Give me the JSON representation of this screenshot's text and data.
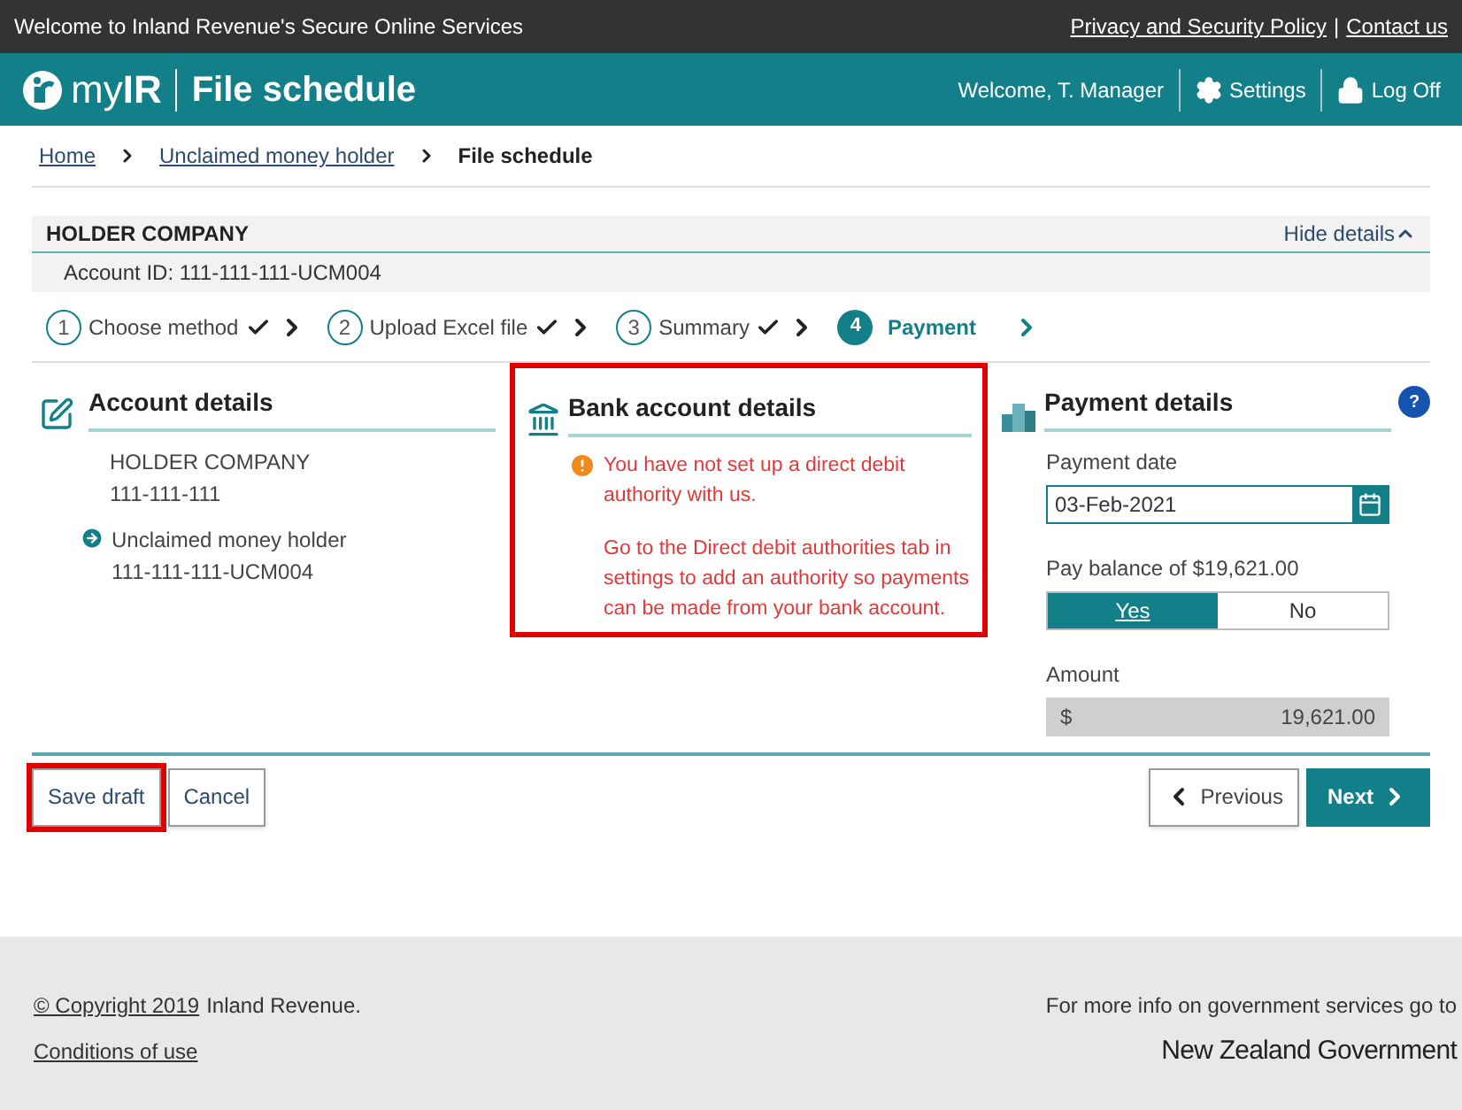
{
  "top_bar": {
    "welcome": "Welcome to Inland Revenue's Secure Online Services",
    "links": [
      "Privacy and Security Policy",
      "Contact us"
    ],
    "separator": "|"
  },
  "header": {
    "logo": "my**IR**",
    "title": "File schedule",
    "user": "Welcome, T. Manager",
    "settings": "Settings",
    "logoff": "Log Off"
  },
  "breadcrumb": [
    {
      "label": "Home",
      "current": false
    },
    {
      "label": "Unclaimed money holder",
      "current": false
    },
    {
      "label": "File schedule",
      "current": true
    }
  ],
  "holder": {
    "name": "HOLDER COMPANY",
    "toggle": "Hide details",
    "account_id": "Account ID: 111-111-111-UCM004"
  },
  "steps": [
    {
      "number": "1",
      "label": "Choose method",
      "done": true,
      "selected": false
    },
    {
      "number": "2",
      "label": "Upload Excel file",
      "done": true,
      "selected": false
    },
    {
      "number": "3",
      "label": "Summary",
      "done": true,
      "selected": false
    },
    {
      "number": "4",
      "label": "Payment",
      "done": false,
      "selected": true
    }
  ],
  "account_details": {
    "title": "Account details",
    "name": "HOLDER COMPANY",
    "number": "111-111-111",
    "link_label": "Unclaimed money holder",
    "link_id": "111-111-111-UCM004"
  },
  "bank_details": {
    "title": "Bank account details",
    "highlighted": true,
    "warning": "You have not set up a direct debit authority with us.",
    "info": "Go to the Direct debit authorities tab in settings to add an authority so payments can be made from your bank account."
  },
  "payment_details": {
    "title": "Payment details",
    "help": "?",
    "date_label": "Payment date",
    "date_value": "03-Feb-2021",
    "balance_label": "Pay balance of $19,621.00",
    "options": [
      {
        "label": "Yes",
        "selected": true
      },
      {
        "label": "No",
        "selected": false
      }
    ],
    "amount_label": "Amount",
    "currency": "$",
    "amount": "19,621.00"
  },
  "actions": [
    {
      "label": "Save draft",
      "kind": "plain",
      "highlighted": true
    },
    {
      "label": "Cancel",
      "kind": "plain",
      "highlighted": false
    },
    {
      "label": "Previous",
      "kind": "back",
      "highlighted": false
    },
    {
      "label": "Next",
      "kind": "primary",
      "highlighted": false
    }
  ],
  "footer": {
    "copyright_link": "© Copyright 2019",
    "copyright_text": "Inland Revenue.",
    "conditions": "Conditions of use",
    "gov_info": "For more info on government services go to",
    "gov_logo": "New Zealand Government"
  }
}
